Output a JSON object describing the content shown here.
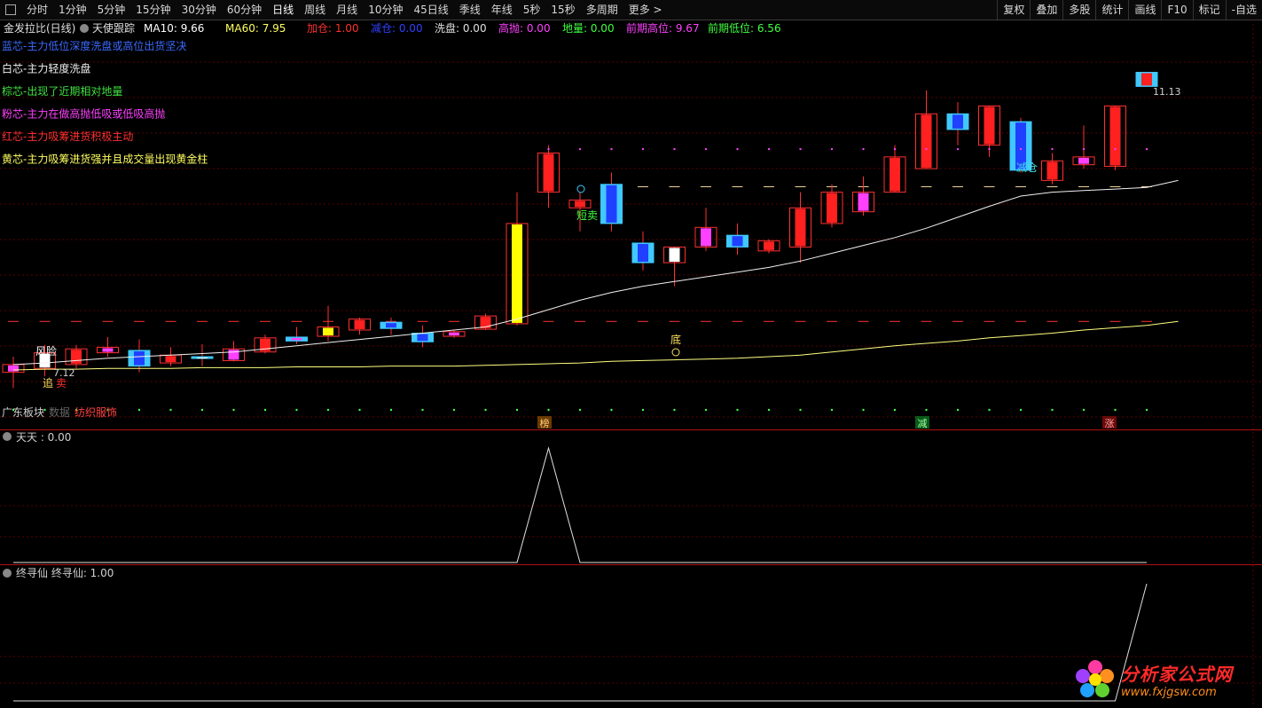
{
  "toolbar": {
    "left": [
      "分时",
      "1分钟",
      "5分钟",
      "15分钟",
      "30分钟",
      "60分钟",
      "日线",
      "周线",
      "月线",
      "10分钟",
      "45日线",
      "季线",
      "年线",
      "5秒",
      "15秒",
      "多周期",
      "更多 >"
    ],
    "active": "日线",
    "right": [
      "复权",
      "叠加",
      "多股",
      "统计",
      "画线",
      "F10",
      "标记",
      "-自选"
    ]
  },
  "header": {
    "title": "金发拉比(日线)",
    "indicator": "天使跟踪",
    "items": [
      {
        "label": "MA10:",
        "value": "9.66",
        "color": "#ffffff"
      },
      {
        "label": "MA60:",
        "value": "7.95",
        "color": "#ffff60"
      },
      {
        "label": "加仓:",
        "value": "1.00",
        "color": "#ff3030"
      },
      {
        "label": "减仓:",
        "value": "0.00",
        "color": "#3040ff"
      },
      {
        "label": "洗盘:",
        "value": "0.00",
        "color": "#e0e0e0"
      },
      {
        "label": "高抛:",
        "value": "0.00",
        "color": "#ff40ff"
      },
      {
        "label": "地量:",
        "value": "0.00",
        "color": "#40ff40"
      },
      {
        "label": "前期高位:",
        "value": "9.67",
        "color": "#ff40ff"
      },
      {
        "label": "前期低位:",
        "value": "6.56",
        "color": "#40ff40"
      }
    ]
  },
  "legend": [
    {
      "text": "蓝芯-主力低位深度洗盘或高位出货坚决",
      "color": "#3a6aff"
    },
    {
      "text": "白芯-主力轻度洗盘",
      "color": "#f0f0f0"
    },
    {
      "text": "棕芯-出现了近期相对地量",
      "color": "#40e040"
    },
    {
      "text": "粉芯-主力在做高抛低吸或低吸高抛",
      "color": "#ff40ff"
    },
    {
      "text": "红芯-主力吸筹进货积极主动",
      "color": "#ff3030"
    },
    {
      "text": "黄芯-主力吸筹进货强并且成交量出现黄金柱",
      "color": "#ffff60"
    }
  ],
  "annotations": {
    "high_price": "11.13",
    "low_price": "7.12",
    "risk": "风险",
    "chase": "追",
    "sell": "卖",
    "short_sell": "短卖",
    "bottom": "底",
    "reduce": "减仓",
    "sector1": "广东板块",
    "sector1_hidden": "数据",
    "sector2": "纺织服饰",
    "mark_bang": "榜",
    "mark_jian": "减",
    "mark_zhang": "涨"
  },
  "panel2": {
    "name": "天天",
    "value": "0.00"
  },
  "panel3": {
    "name": "终寻仙",
    "label": "终寻仙:",
    "value": "1.00"
  },
  "watermark": {
    "title": "分析家公式网",
    "url": "www.fxjgsw.com"
  },
  "chart_data": {
    "type": "candlestick",
    "candles": [
      {
        "o": 7.3,
        "h": 7.5,
        "l": 7.1,
        "c": 7.4,
        "core": "#ff40ff"
      },
      {
        "o": 7.35,
        "h": 7.65,
        "l": 7.25,
        "c": 7.55,
        "core": "#ffffff"
      },
      {
        "o": 7.4,
        "h": 7.65,
        "l": 7.35,
        "c": 7.6,
        "core": "#ff2020"
      },
      {
        "o": 7.55,
        "h": 7.75,
        "l": 7.5,
        "c": 7.62,
        "core": "#ff40ff"
      },
      {
        "o": 7.58,
        "h": 7.72,
        "l": 7.3,
        "c": 7.38,
        "core": "#2040ff"
      },
      {
        "o": 7.42,
        "h": 7.62,
        "l": 7.38,
        "c": 7.52,
        "core": "#ff2020"
      },
      {
        "o": 7.5,
        "h": 7.66,
        "l": 7.38,
        "c": 7.48,
        "core": "#ffffff"
      },
      {
        "o": 7.45,
        "h": 7.7,
        "l": 7.44,
        "c": 7.6,
        "core": "#ff40ff"
      },
      {
        "o": 7.56,
        "h": 7.78,
        "l": 7.54,
        "c": 7.74,
        "core": "#ff2020"
      },
      {
        "o": 7.75,
        "h": 7.88,
        "l": 7.66,
        "c": 7.7,
        "core": "#ff40ff"
      },
      {
        "o": 7.76,
        "h": 8.15,
        "l": 7.7,
        "c": 7.88,
        "core": "#ffff00"
      },
      {
        "o": 7.84,
        "h": 8.0,
        "l": 7.78,
        "c": 7.98,
        "core": "#ff2020"
      },
      {
        "o": 7.94,
        "h": 8.0,
        "l": 7.78,
        "c": 7.86,
        "core": "#2040ff"
      },
      {
        "o": 7.8,
        "h": 7.9,
        "l": 7.62,
        "c": 7.69,
        "core": "#2040ff"
      },
      {
        "o": 7.76,
        "h": 7.84,
        "l": 7.74,
        "c": 7.82,
        "core": "#ff40ff"
      },
      {
        "o": 7.85,
        "h": 8.05,
        "l": 7.84,
        "c": 8.02,
        "core": "#ff2020"
      },
      {
        "o": 7.92,
        "h": 9.6,
        "l": 7.9,
        "c": 9.2,
        "core": "#ffff00"
      },
      {
        "o": 9.6,
        "h": 10.2,
        "l": 9.4,
        "c": 10.1,
        "core": "#ff2020"
      },
      {
        "o": 9.4,
        "h": 9.6,
        "l": 9.1,
        "c": 9.5,
        "core": "#ff2020"
      },
      {
        "o": 9.7,
        "h": 9.85,
        "l": 9.1,
        "c": 9.2,
        "core": "#2040ff"
      },
      {
        "o": 8.95,
        "h": 9.1,
        "l": 8.6,
        "c": 8.7,
        "core": "#2040ff"
      },
      {
        "o": 8.7,
        "h": 8.9,
        "l": 8.4,
        "c": 8.9,
        "core": "#ffffff"
      },
      {
        "o": 8.9,
        "h": 9.4,
        "l": 8.85,
        "c": 9.15,
        "core": "#ff40ff"
      },
      {
        "o": 9.05,
        "h": 9.2,
        "l": 8.8,
        "c": 8.9,
        "core": "#2040ff"
      },
      {
        "o": 8.85,
        "h": 9.0,
        "l": 8.82,
        "c": 8.98,
        "core": "#ff2020"
      },
      {
        "o": 8.9,
        "h": 9.6,
        "l": 8.7,
        "c": 9.4,
        "core": "#ff2020"
      },
      {
        "o": 9.2,
        "h": 9.7,
        "l": 9.15,
        "c": 9.6,
        "core": "#ff2020"
      },
      {
        "o": 9.35,
        "h": 9.8,
        "l": 9.3,
        "c": 9.6,
        "core": "#ff40ff"
      },
      {
        "o": 9.6,
        "h": 10.2,
        "l": 9.6,
        "c": 10.05,
        "core": "#ff2020"
      },
      {
        "o": 9.9,
        "h": 10.9,
        "l": 9.9,
        "c": 10.6,
        "core": "#ff2020"
      },
      {
        "o": 10.6,
        "h": 10.75,
        "l": 10.2,
        "c": 10.4,
        "core": "#2040ff"
      },
      {
        "o": 10.2,
        "h": 10.7,
        "l": 10.05,
        "c": 10.7,
        "core": "#ff2020"
      },
      {
        "o": 10.5,
        "h": 10.55,
        "l": 9.85,
        "c": 9.88,
        "core": "#2040ff"
      },
      {
        "o": 9.75,
        "h": 10.1,
        "l": 9.7,
        "c": 10.0,
        "core": "#ff2020"
      },
      {
        "o": 9.95,
        "h": 10.45,
        "l": 9.9,
        "c": 10.05,
        "core": "#ff40ff"
      },
      {
        "o": 9.93,
        "h": 10.7,
        "l": 9.88,
        "c": 10.7,
        "core": "#ff2020"
      },
      {
        "o": 11.13,
        "h": 11.13,
        "l": 10.95,
        "c": 10.95,
        "core": "#ff2020"
      }
    ],
    "ma10": [
      7.4,
      7.42,
      7.45,
      7.48,
      7.5,
      7.52,
      7.54,
      7.56,
      7.6,
      7.64,
      7.68,
      7.72,
      7.76,
      7.8,
      7.84,
      7.88,
      7.98,
      8.1,
      8.22,
      8.32,
      8.4,
      8.46,
      8.52,
      8.58,
      8.64,
      8.72,
      8.82,
      8.92,
      9.02,
      9.14,
      9.28,
      9.42,
      9.55,
      9.6,
      9.62,
      9.64,
      9.66,
      9.75,
      9.9
    ],
    "ma60": [
      7.33,
      7.34,
      7.34,
      7.35,
      7.35,
      7.35,
      7.36,
      7.36,
      7.36,
      7.37,
      7.37,
      7.37,
      7.38,
      7.38,
      7.38,
      7.39,
      7.4,
      7.41,
      7.42,
      7.44,
      7.45,
      7.46,
      7.47,
      7.48,
      7.5,
      7.52,
      7.56,
      7.6,
      7.64,
      7.67,
      7.7,
      7.74,
      7.77,
      7.8,
      7.84,
      7.87,
      7.9,
      7.95
    ],
    "high_marker": 10.15,
    "upper_level": 9.67,
    "lower_level": 7.95,
    "ylim": [
      6.9,
      11.6
    ],
    "panel2_values": [
      0,
      0,
      0,
      0,
      0,
      0,
      0,
      0,
      0,
      0,
      0,
      0,
      0,
      0,
      0,
      0,
      0,
      1,
      0,
      0,
      0,
      0,
      0,
      0,
      0,
      0,
      0,
      0,
      0,
      0,
      0,
      0,
      0,
      0,
      0,
      0,
      0
    ],
    "panel3_values": [
      0,
      0,
      0,
      0,
      0,
      0,
      0,
      0,
      0,
      0,
      0,
      0,
      0,
      0,
      0,
      0,
      0,
      0,
      0,
      0,
      0,
      0,
      0,
      0,
      0,
      0,
      0,
      0,
      0,
      0,
      0,
      0,
      0,
      0,
      0,
      0,
      1
    ]
  }
}
